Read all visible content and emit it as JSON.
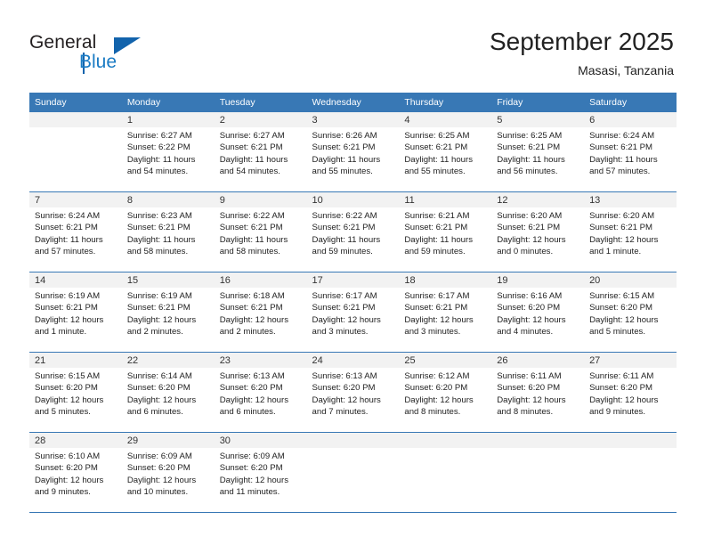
{
  "logo": {
    "part1": "General",
    "part2": "Blue",
    "triangle_color": "#1263ac"
  },
  "header": {
    "title": "September 2025",
    "subtitle": "Masasi, Tanzania",
    "header_bg": "#3878b5",
    "header_text_color": "#ffffff"
  },
  "weekdays": [
    "Sunday",
    "Monday",
    "Tuesday",
    "Wednesday",
    "Thursday",
    "Friday",
    "Saturday"
  ],
  "weeks": [
    [
      {
        "day": "",
        "sunrise": "",
        "sunset": "",
        "daylight1": "",
        "daylight2": ""
      },
      {
        "day": "1",
        "sunrise": "Sunrise: 6:27 AM",
        "sunset": "Sunset: 6:22 PM",
        "daylight1": "Daylight: 11 hours",
        "daylight2": "and 54 minutes."
      },
      {
        "day": "2",
        "sunrise": "Sunrise: 6:27 AM",
        "sunset": "Sunset: 6:21 PM",
        "daylight1": "Daylight: 11 hours",
        "daylight2": "and 54 minutes."
      },
      {
        "day": "3",
        "sunrise": "Sunrise: 6:26 AM",
        "sunset": "Sunset: 6:21 PM",
        "daylight1": "Daylight: 11 hours",
        "daylight2": "and 55 minutes."
      },
      {
        "day": "4",
        "sunrise": "Sunrise: 6:25 AM",
        "sunset": "Sunset: 6:21 PM",
        "daylight1": "Daylight: 11 hours",
        "daylight2": "and 55 minutes."
      },
      {
        "day": "5",
        "sunrise": "Sunrise: 6:25 AM",
        "sunset": "Sunset: 6:21 PM",
        "daylight1": "Daylight: 11 hours",
        "daylight2": "and 56 minutes."
      },
      {
        "day": "6",
        "sunrise": "Sunrise: 6:24 AM",
        "sunset": "Sunset: 6:21 PM",
        "daylight1": "Daylight: 11 hours",
        "daylight2": "and 57 minutes."
      }
    ],
    [
      {
        "day": "7",
        "sunrise": "Sunrise: 6:24 AM",
        "sunset": "Sunset: 6:21 PM",
        "daylight1": "Daylight: 11 hours",
        "daylight2": "and 57 minutes."
      },
      {
        "day": "8",
        "sunrise": "Sunrise: 6:23 AM",
        "sunset": "Sunset: 6:21 PM",
        "daylight1": "Daylight: 11 hours",
        "daylight2": "and 58 minutes."
      },
      {
        "day": "9",
        "sunrise": "Sunrise: 6:22 AM",
        "sunset": "Sunset: 6:21 PM",
        "daylight1": "Daylight: 11 hours",
        "daylight2": "and 58 minutes."
      },
      {
        "day": "10",
        "sunrise": "Sunrise: 6:22 AM",
        "sunset": "Sunset: 6:21 PM",
        "daylight1": "Daylight: 11 hours",
        "daylight2": "and 59 minutes."
      },
      {
        "day": "11",
        "sunrise": "Sunrise: 6:21 AM",
        "sunset": "Sunset: 6:21 PM",
        "daylight1": "Daylight: 11 hours",
        "daylight2": "and 59 minutes."
      },
      {
        "day": "12",
        "sunrise": "Sunrise: 6:20 AM",
        "sunset": "Sunset: 6:21 PM",
        "daylight1": "Daylight: 12 hours",
        "daylight2": "and 0 minutes."
      },
      {
        "day": "13",
        "sunrise": "Sunrise: 6:20 AM",
        "sunset": "Sunset: 6:21 PM",
        "daylight1": "Daylight: 12 hours",
        "daylight2": "and 1 minute."
      }
    ],
    [
      {
        "day": "14",
        "sunrise": "Sunrise: 6:19 AM",
        "sunset": "Sunset: 6:21 PM",
        "daylight1": "Daylight: 12 hours",
        "daylight2": "and 1 minute."
      },
      {
        "day": "15",
        "sunrise": "Sunrise: 6:19 AM",
        "sunset": "Sunset: 6:21 PM",
        "daylight1": "Daylight: 12 hours",
        "daylight2": "and 2 minutes."
      },
      {
        "day": "16",
        "sunrise": "Sunrise: 6:18 AM",
        "sunset": "Sunset: 6:21 PM",
        "daylight1": "Daylight: 12 hours",
        "daylight2": "and 2 minutes."
      },
      {
        "day": "17",
        "sunrise": "Sunrise: 6:17 AM",
        "sunset": "Sunset: 6:21 PM",
        "daylight1": "Daylight: 12 hours",
        "daylight2": "and 3 minutes."
      },
      {
        "day": "18",
        "sunrise": "Sunrise: 6:17 AM",
        "sunset": "Sunset: 6:21 PM",
        "daylight1": "Daylight: 12 hours",
        "daylight2": "and 3 minutes."
      },
      {
        "day": "19",
        "sunrise": "Sunrise: 6:16 AM",
        "sunset": "Sunset: 6:20 PM",
        "daylight1": "Daylight: 12 hours",
        "daylight2": "and 4 minutes."
      },
      {
        "day": "20",
        "sunrise": "Sunrise: 6:15 AM",
        "sunset": "Sunset: 6:20 PM",
        "daylight1": "Daylight: 12 hours",
        "daylight2": "and 5 minutes."
      }
    ],
    [
      {
        "day": "21",
        "sunrise": "Sunrise: 6:15 AM",
        "sunset": "Sunset: 6:20 PM",
        "daylight1": "Daylight: 12 hours",
        "daylight2": "and 5 minutes."
      },
      {
        "day": "22",
        "sunrise": "Sunrise: 6:14 AM",
        "sunset": "Sunset: 6:20 PM",
        "daylight1": "Daylight: 12 hours",
        "daylight2": "and 6 minutes."
      },
      {
        "day": "23",
        "sunrise": "Sunrise: 6:13 AM",
        "sunset": "Sunset: 6:20 PM",
        "daylight1": "Daylight: 12 hours",
        "daylight2": "and 6 minutes."
      },
      {
        "day": "24",
        "sunrise": "Sunrise: 6:13 AM",
        "sunset": "Sunset: 6:20 PM",
        "daylight1": "Daylight: 12 hours",
        "daylight2": "and 7 minutes."
      },
      {
        "day": "25",
        "sunrise": "Sunrise: 6:12 AM",
        "sunset": "Sunset: 6:20 PM",
        "daylight1": "Daylight: 12 hours",
        "daylight2": "and 8 minutes."
      },
      {
        "day": "26",
        "sunrise": "Sunrise: 6:11 AM",
        "sunset": "Sunset: 6:20 PM",
        "daylight1": "Daylight: 12 hours",
        "daylight2": "and 8 minutes."
      },
      {
        "day": "27",
        "sunrise": "Sunrise: 6:11 AM",
        "sunset": "Sunset: 6:20 PM",
        "daylight1": "Daylight: 12 hours",
        "daylight2": "and 9 minutes."
      }
    ],
    [
      {
        "day": "28",
        "sunrise": "Sunrise: 6:10 AM",
        "sunset": "Sunset: 6:20 PM",
        "daylight1": "Daylight: 12 hours",
        "daylight2": "and 9 minutes."
      },
      {
        "day": "29",
        "sunrise": "Sunrise: 6:09 AM",
        "sunset": "Sunset: 6:20 PM",
        "daylight1": "Daylight: 12 hours",
        "daylight2": "and 10 minutes."
      },
      {
        "day": "30",
        "sunrise": "Sunrise: 6:09 AM",
        "sunset": "Sunset: 6:20 PM",
        "daylight1": "Daylight: 12 hours",
        "daylight2": "and 11 minutes."
      },
      {
        "day": "",
        "sunrise": "",
        "sunset": "",
        "daylight1": "",
        "daylight2": ""
      },
      {
        "day": "",
        "sunrise": "",
        "sunset": "",
        "daylight1": "",
        "daylight2": ""
      },
      {
        "day": "",
        "sunrise": "",
        "sunset": "",
        "daylight1": "",
        "daylight2": ""
      },
      {
        "day": "",
        "sunrise": "",
        "sunset": "",
        "daylight1": "",
        "daylight2": ""
      }
    ]
  ]
}
